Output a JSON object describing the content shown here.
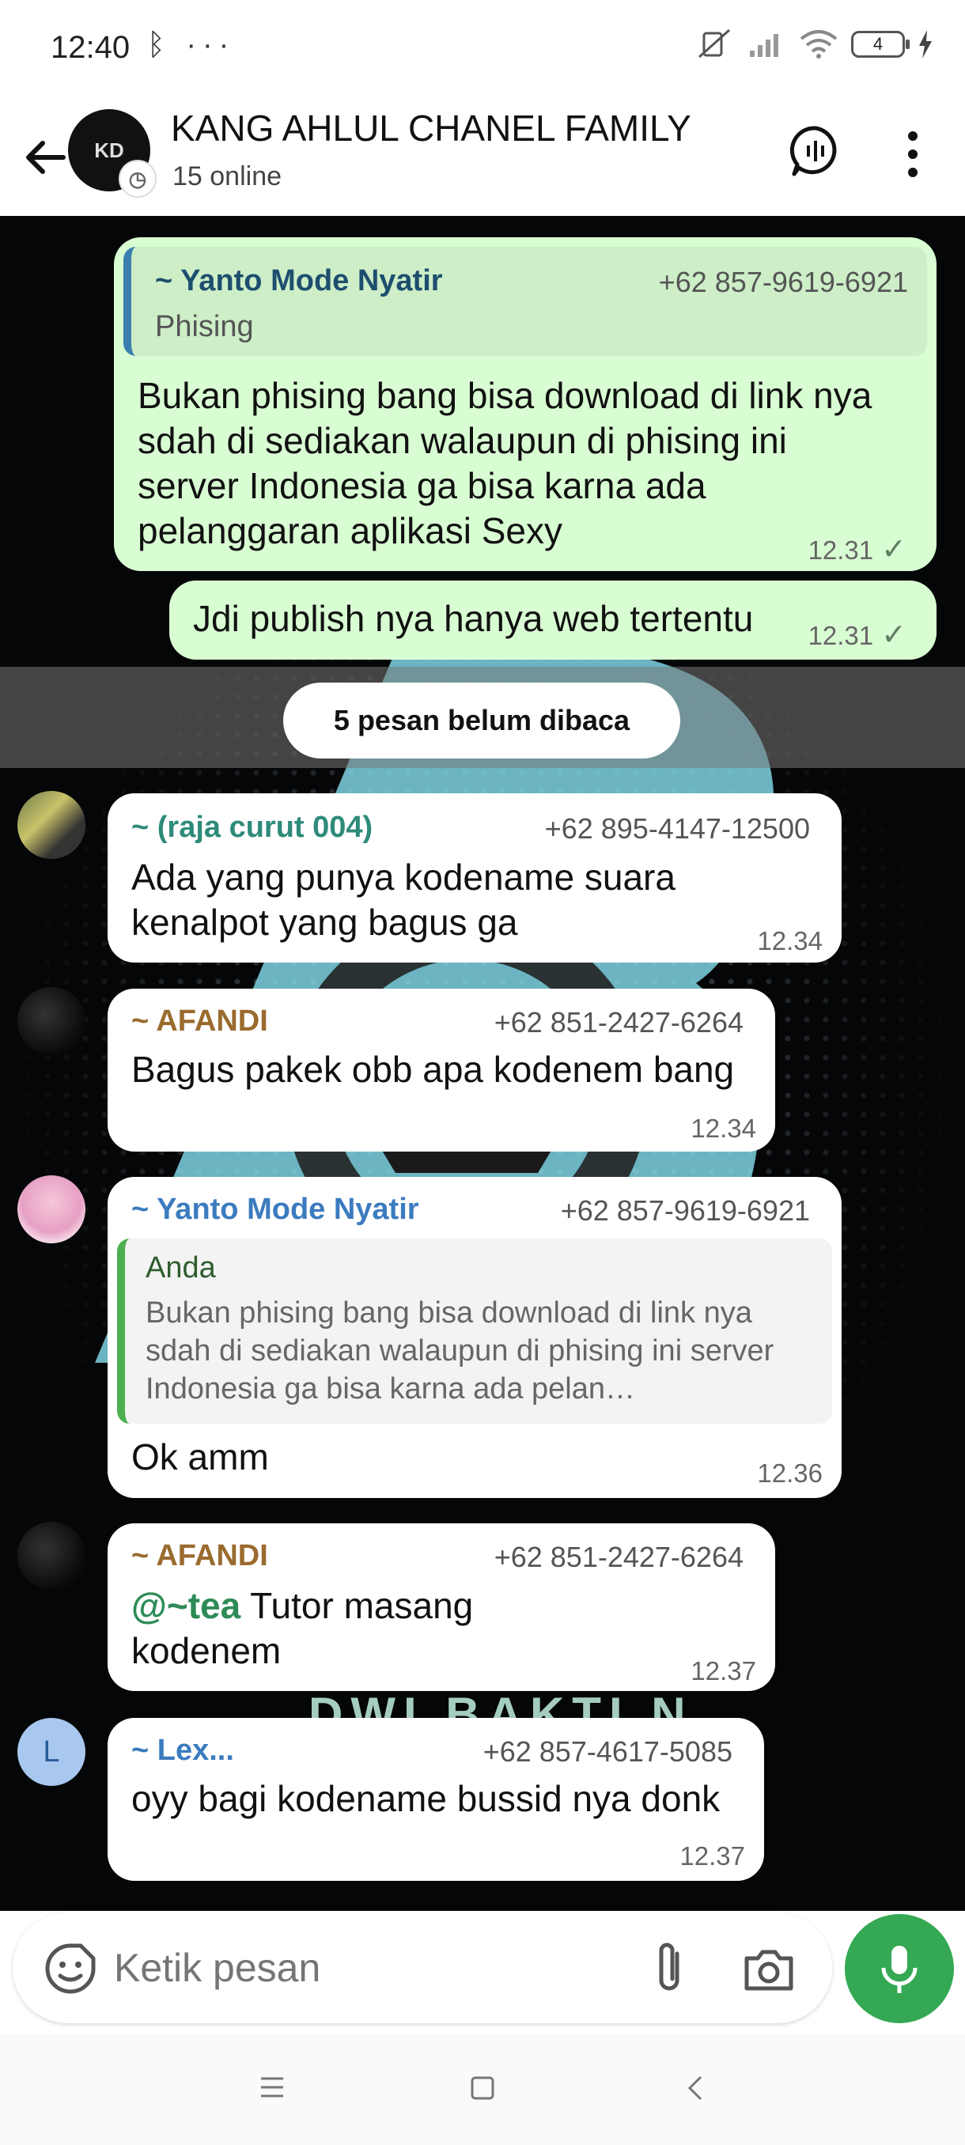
{
  "status_bar": {
    "time": "12:40",
    "left_icons": "ᛒ ···",
    "battery": "4"
  },
  "header": {
    "title": "KANG AHLUL CHANEL FAMILY",
    "subtitle": "15 online",
    "avatar_text": "KD"
  },
  "messages": {
    "m1": {
      "quote_sender": "~ Yanto Mode Nyatir",
      "quote_phone": "+62 857-9619-6921",
      "quote_text": "Phising",
      "text": "Bukan phising bang bisa download di link nya sdah di sediakan walaupun di phising ini server Indonesia ga bisa karna ada pelanggaran aplikasi Sexy",
      "time": "12.31",
      "tick": "✓"
    },
    "m2": {
      "text": "Jdi publish nya hanya web tertentu",
      "time": "12.31",
      "tick": "✓"
    },
    "unread": "5 pesan belum dibaca",
    "m3": {
      "sender": "~ (raja curut 004)",
      "phone": "+62 895-4147-12500",
      "text": "Ada yang punya kodename suara kenalpot yang bagus ga",
      "time": "12.34"
    },
    "m4": {
      "sender": "~ AFANDI",
      "phone": "+62 851-2427-6264",
      "text": "Bagus pakek obb apa kodenem bang",
      "time": "12.34"
    },
    "m5": {
      "sender": "~ Yanto Mode Nyatir",
      "phone": "+62 857-9619-6921",
      "quote_sender": "Anda",
      "quote_text": "Bukan phising bang bisa download di link nya sdah di sediakan walaupun di phising ini server Indonesia ga bisa karna ada pelan…",
      "text": "Ok amm",
      "time": "12.36"
    },
    "m6": {
      "sender": "~ AFANDI",
      "phone": "+62 851-2427-6264",
      "mention": "@~tea",
      "text": " Tutor masang kodenem",
      "time": "12.37"
    },
    "m7": {
      "sender": "~ Lex...",
      "phone": "+62 857-4617-5085",
      "text": "oyy bagi kodename bussid nya donk",
      "time": "12.37",
      "avatar_letter": "L"
    }
  },
  "wallpaper_text": "DWI BAKTI N",
  "composer": {
    "placeholder": "Ketik pesan"
  },
  "colors": {
    "outgoing_bubble": "#d9fdd3",
    "incoming_bubble": "#ffffff",
    "accent_green": "#34a853",
    "sender_teal": "#2e8b7a",
    "sender_brown": "#9a6b2f",
    "sender_blue": "#3b7bbf"
  },
  "icons": [
    "back-arrow-icon",
    "voice-chat-icon",
    "more-vert-icon",
    "emoji-icon",
    "attach-icon",
    "camera-icon",
    "mic-icon",
    "recent-apps-icon",
    "home-icon",
    "back-nav-icon"
  ]
}
